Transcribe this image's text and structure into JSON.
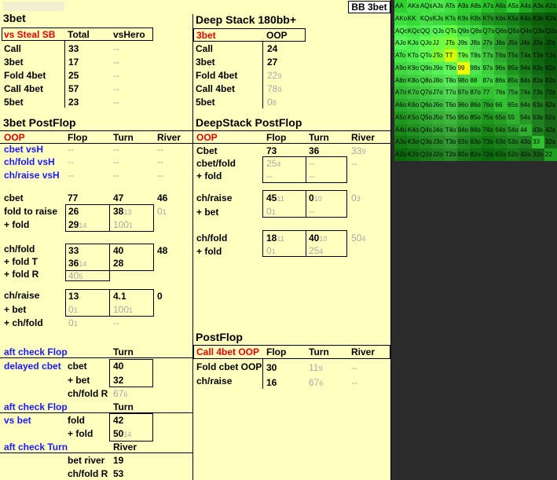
{
  "tag": "BB 3bet",
  "threebet": {
    "title": "3bet",
    "header": [
      "vs Steal SB",
      "Total",
      "vsHero"
    ],
    "rows": [
      {
        "label": "Call",
        "total": "33",
        "hero": "--"
      },
      {
        "label": "3bet",
        "total": "17",
        "hero": "--"
      },
      {
        "label": "Fold 4bet",
        "total": "25",
        "hero": "--"
      },
      {
        "label": "Call 4bet",
        "total": "57",
        "hero": "--"
      },
      {
        "label": "5bet",
        "total": "23",
        "hero": "--"
      }
    ]
  },
  "deepstack": {
    "title": "Deep Stack 180bb+",
    "header": [
      "3bet",
      "OOP"
    ],
    "rows": [
      {
        "label": "Call",
        "v": "24",
        "s": ""
      },
      {
        "label": "3bet",
        "v": "27",
        "s": ""
      },
      {
        "label": "Fold 4bet",
        "v": "22",
        "s": "9"
      },
      {
        "label": "Call 4bet",
        "v": "78",
        "s": "9"
      },
      {
        "label": "5bet",
        "v": "0",
        "s": "8"
      }
    ]
  },
  "postflop3bet": {
    "title": "3bet PostFlop",
    "header": [
      "OOP",
      "Flop",
      "Turn",
      "River"
    ],
    "vsh": [
      {
        "label": "cbet vsH",
        "flop": "--",
        "turn": "--",
        "river": "--"
      },
      {
        "label": "ch/fold vsH",
        "flop": "--",
        "turn": "--",
        "river": "--"
      },
      {
        "label": "ch/raise vsH",
        "flop": "--",
        "turn": "--",
        "river": "--"
      }
    ],
    "cbet": {
      "label": "cbet",
      "flop": "77",
      "turn": "47",
      "river": "46"
    },
    "ftr": {
      "label": "fold to raise",
      "label2": "+ fold",
      "flop": "26",
      "flop2": "29",
      "flop2s": "14",
      "turn": "38",
      "turns": "13",
      "turn2": "100",
      "turn2s": "1",
      "river": "0",
      "rivers": "1"
    },
    "chfold": {
      "label": "ch/fold",
      "label2": "+ fold T",
      "label3": "+ fold R",
      "flop": "33",
      "flop2": "36",
      "flop2s": "14",
      "flop3": "40",
      "flop3s": "5",
      "turn": "40",
      "turn2": "28",
      "river": "48"
    },
    "chraise": {
      "label": "ch/raise",
      "label2": "+ bet",
      "label3": "+ ch/fold",
      "flop": "13",
      "flop2": "0",
      "flop2s": "1",
      "flop3": "0",
      "flop3s": "1",
      "turn": "4.1",
      "turn2": "100",
      "turn2s": "1",
      "turn3": "--",
      "river": "0"
    }
  },
  "dsPostflop": {
    "title": "DeepStack PostFlop",
    "header": [
      "OOP",
      "Flop",
      "Turn",
      "River"
    ],
    "cbet": {
      "label": "Cbet",
      "flop": "73",
      "turn": "36",
      "river": "33",
      "rivers": "9"
    },
    "cbetfold": {
      "label": "cbet/fold",
      "label2": "+ fold",
      "flop": "25",
      "flops": "4",
      "flop2": "--",
      "turn": "--",
      "turn2": "--",
      "river": "--"
    },
    "chraise": {
      "label": "ch/raise",
      "label2": "+ bet",
      "flop": "45",
      "flops": "11",
      "flop2": "0",
      "flop2s": "1",
      "turn": "0",
      "turns": "10",
      "turn2": "--",
      "river": "0",
      "rivers": "3"
    },
    "chfold": {
      "label": "ch/fold",
      "label2": "+ fold",
      "flop": "18",
      "flops": "11",
      "flop2": "0",
      "flop2s": "1",
      "turn": "40",
      "turns": "10",
      "turn2": "25",
      "turn2s": "4",
      "river": "50",
      "rivers": "4"
    }
  },
  "afc": {
    "sec1": {
      "title": "aft check Flop",
      "col": "Turn",
      "label": "delayed cbet",
      "sub1": "cbet",
      "v1": "40",
      "sub2": "+ bet",
      "v2": "32",
      "sub3": "ch/fold R",
      "v3": "67",
      "v3s": "6"
    },
    "sec2": {
      "title": "aft check Flop",
      "col": "Turn",
      "label": "vs bet",
      "sub1": "fold",
      "v1": "42",
      "sub2": "+ fold",
      "v2": "50",
      "v2s": "14"
    },
    "sec3": {
      "title": "aft check Turn",
      "col": "River",
      "sub1": "bet river",
      "v1": "19",
      "sub2": "ch/fold R",
      "v2": "53"
    }
  },
  "postflop": {
    "title": "PostFlop",
    "header": [
      "Call 4bet OOP",
      "Flop",
      "Turn",
      "River"
    ],
    "rows": [
      {
        "label": "Fold cbet OOP",
        "flop": "30",
        "turn": "11",
        "turns": "9",
        "river": "--"
      },
      {
        "label": "ch/raise",
        "flop": "16",
        "turn": "67",
        "turns": "6",
        "river": "--"
      }
    ]
  },
  "matrix": {
    "cells": [
      "AA",
      "AKs",
      "AQs",
      "AJs",
      "ATs",
      "A9s",
      "A8s",
      "A7s",
      "A6s",
      "A5s",
      "A4s",
      "A3s",
      "A2s",
      "AKo",
      "KK",
      "KQs",
      "KJs",
      "KTs",
      "K9s",
      "K8s",
      "K7s",
      "K6s",
      "K5s",
      "K4s",
      "K3s",
      "K2s",
      "AQo",
      "KQo",
      "QQ",
      "QJs",
      "QTs",
      "Q9s",
      "Q8s",
      "Q7s",
      "Q6s",
      "Q5s",
      "Q4s",
      "Q3s",
      "Q2s",
      "AJo",
      "KJo",
      "QJo",
      "JJ",
      "JTs",
      "J9s",
      "J8s",
      "J7s",
      "J6s",
      "J5s",
      "J4s",
      "J3s",
      "J2s",
      "ATo",
      "KTo",
      "QTo",
      "JTo",
      "TT",
      "T9s",
      "T8s",
      "T7s",
      "T6s",
      "T5s",
      "T4s",
      "T3s",
      "T2s",
      "A9o",
      "K9o",
      "Q9o",
      "J9o",
      "T9o",
      "99",
      "98s",
      "97s",
      "96s",
      "95s",
      "94s",
      "93s",
      "92s",
      "A8o",
      "K8o",
      "Q8o",
      "J8o",
      "T8o",
      "98o",
      "88",
      "87s",
      "86s",
      "85s",
      "84s",
      "83s",
      "82s",
      "A7o",
      "K7o",
      "Q7o",
      "J7o",
      "T7o",
      "97o",
      "87o",
      "77",
      "76s",
      "75s",
      "74s",
      "73s",
      "72s",
      "A6o",
      "K6o",
      "Q6o",
      "J6o",
      "T6o",
      "96o",
      "86o",
      "76o",
      "66",
      "65s",
      "64s",
      "63s",
      "62s",
      "A5o",
      "K5o",
      "Q5o",
      "J5o",
      "T5o",
      "95o",
      "85o",
      "75o",
      "65o",
      "55",
      "54s",
      "53s",
      "52s",
      "A4o",
      "K4o",
      "Q4o",
      "J4o",
      "T4o",
      "94o",
      "84o",
      "74o",
      "64o",
      "54o",
      "44",
      "43s",
      "42s",
      "A3o",
      "K3o",
      "Q3o",
      "J3o",
      "T3o",
      "93o",
      "83o",
      "73o",
      "63o",
      "53o",
      "43o",
      "33",
      "32s",
      "A2o",
      "K2o",
      "Q2o",
      "J2o",
      "T2o",
      "92o",
      "82o",
      "72o",
      "62o",
      "52o",
      "42o",
      "32o",
      "22"
    ],
    "colors": [
      "#30d030",
      "#40e040",
      "#40e040",
      "#50e850",
      "#40e040",
      "#30d030",
      "#30d030",
      "#28c028",
      "#22b022",
      "#30d030",
      "#20a820",
      "#188818",
      "#108010",
      "#40e040",
      "#38d838",
      "#48e048",
      "#40d840",
      "#38d838",
      "#30c830",
      "#28b828",
      "#229822",
      "#1c901c",
      "#188018",
      "#107010",
      "#0c600c",
      "#0a5a0a",
      "#50f050",
      "#48e848",
      "#50f050",
      "#58f858",
      "#60ff40",
      "#48e048",
      "#40d840",
      "#30c030",
      "#28a828",
      "#209020",
      "#187818",
      "#106810",
      "#0c5c0c",
      "#58f858",
      "#50f050",
      "#60ff50",
      "#70ff40",
      "#80ff30",
      "#60f050",
      "#48d848",
      "#38b838",
      "#28a028",
      "#208820",
      "#187018",
      "#106010",
      "#0a580a",
      "#48e848",
      "#50f050",
      "#60ff50",
      "#80ff30",
      "#d0ff00",
      "#70ff40",
      "#50e050",
      "#40c840",
      "#30a830",
      "#209020",
      "#187818",
      "#106410",
      "#0a560a",
      "#40d840",
      "#48e048",
      "#50e850",
      "#58f058",
      "#60f858",
      "#f0ff00",
      "#50e850",
      "#40d040",
      "#30b830",
      "#209820",
      "#188018",
      "#106810",
      "#0a580a",
      "#38c838",
      "#40d040",
      "#48d848",
      "#50e050",
      "#58e858",
      "#48d848",
      "#40e040",
      "#40d840",
      "#38c838",
      "#28a828",
      "#208820",
      "#187018",
      "#105c10",
      "#30b830",
      "#38c038",
      "#40c840",
      "#48d048",
      "#50d850",
      "#40c040",
      "#38c038",
      "#30c030",
      "#38c838",
      "#30b030",
      "#209020",
      "#187818",
      "#106010",
      "#28a828",
      "#30b030",
      "#38b838",
      "#40c040",
      "#48c848",
      "#38b838",
      "#30b030",
      "#28a828",
      "#30c030",
      "#30b830",
      "#289828",
      "#208020",
      "#186818",
      "#209820",
      "#28a028",
      "#30a830",
      "#38b038",
      "#40b840",
      "#30a830",
      "#28a028",
      "#209820",
      "#28a028",
      "#30b030",
      "#289828",
      "#208020",
      "#186818",
      "#188818",
      "#209020",
      "#289828",
      "#30a030",
      "#38a838",
      "#289828",
      "#209020",
      "#188818",
      "#209020",
      "#289828",
      "#30b030",
      "#208020",
      "#186818",
      "#107810",
      "#188018",
      "#208820",
      "#289028",
      "#309830",
      "#208820",
      "#188018",
      "#107810",
      "#188018",
      "#208820",
      "#208020",
      "#30c030",
      "#186818",
      "#0c680c",
      "#107010",
      "#187818",
      "#208020",
      "#288828",
      "#187818",
      "#107010",
      "#0c680c",
      "#107010",
      "#187818",
      "#186818",
      "#186818",
      "#20a020"
    ]
  }
}
